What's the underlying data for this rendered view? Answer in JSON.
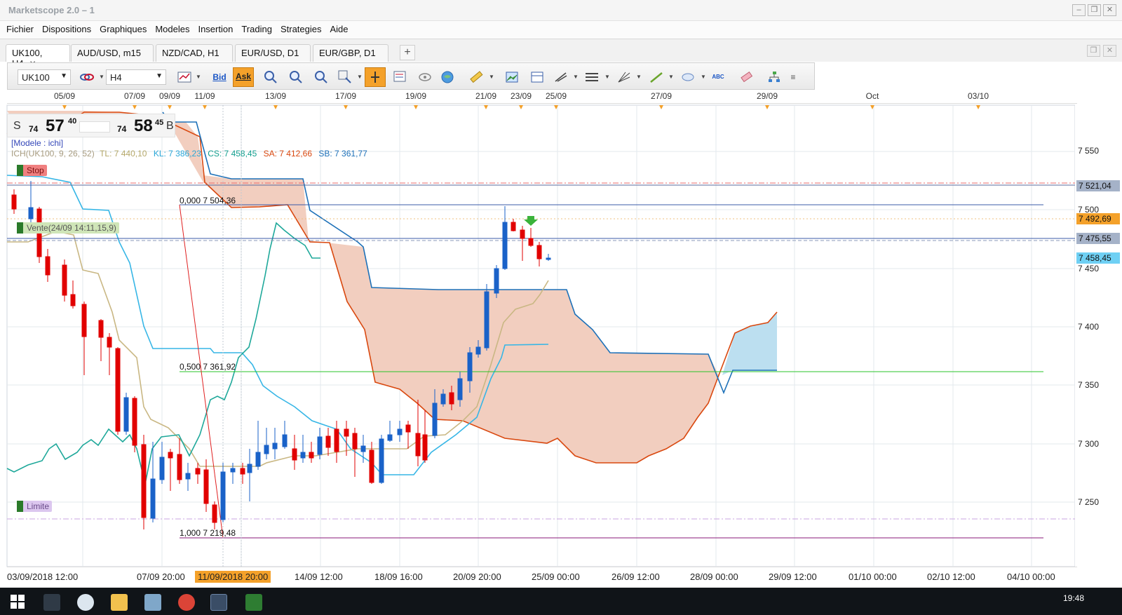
{
  "window": {
    "title": "Marketscope 2.0 – 1"
  },
  "menu": [
    "Fichier",
    "Dispositions",
    "Graphiques",
    "Modeles",
    "Insertion",
    "Trading",
    "Strategies",
    "Aide"
  ],
  "tabs": [
    {
      "label": "UK100, H4",
      "active": true,
      "close": "✕"
    },
    {
      "label": "AUD/USD, m15"
    },
    {
      "label": "NZD/CAD, H1"
    },
    {
      "label": "EUR/USD, D1"
    },
    {
      "label": "EUR/GBP, D1"
    }
  ],
  "toolbar": {
    "symbol": "UK100",
    "timeframe": "H4",
    "bid_label": "Bid",
    "ask_label": "Ask"
  },
  "top_dates": [
    "05/09",
    "07/09",
    "09/09",
    "11/09",
    "13/09",
    "17/09",
    "19/09",
    "21/09",
    "23/09",
    "25/09",
    "27/09",
    "29/09",
    "Oct",
    "03/10"
  ],
  "quote": {
    "sell_letter": "S",
    "sell_small": "74",
    "sell_big": "57",
    "sell_sup": "40",
    "buy_small": "74",
    "buy_big": "58",
    "buy_sup": "45",
    "buy_letter": "B"
  },
  "model_line": "[Modele : ichi]",
  "ichimoku": {
    "name": "ICH(UK100, 9, 26, 52)",
    "tl": "TL: 7 440,10",
    "kl": "KL: 7 386,23",
    "cs": "CS: 7 458,45",
    "sa": "SA: 7 412,66",
    "sb": "SB: 7 361,77",
    "colors": {
      "tl": "#c9b783",
      "kl": "#36b6e6",
      "cs": "#1ea89a",
      "sa": "#d9480f",
      "sb": "#1c70b8",
      "cloud": "#f2c9b6"
    }
  },
  "tags": {
    "stop": "Stop",
    "vente": "Vente(24/09 14:11,15,9)",
    "limite": "Limite"
  },
  "fib": {
    "f0": "0,000 7 504,36",
    "f50": "0,500 7 361,92",
    "f100": "1,000 7 219,48"
  },
  "price_axis": {
    "ticks": [
      "7 550",
      "7 500",
      "7 450",
      "7 400",
      "7 350",
      "7 300",
      "7 250"
    ],
    "labels": {
      "stop": "7 521,04",
      "ask": "7 492,69",
      "entry": "7 475,55",
      "cs": "7 458,45"
    }
  },
  "bottom_dates": [
    "03/09/2018 12:00",
    "07/09 20:00",
    "11/09/2018 20:00",
    "14/09 12:00",
    "18/09 16:00",
    "20/09 20:00",
    "25/09 00:00",
    "26/09 12:00",
    "28/09 00:00",
    "29/09 12:00",
    "01/10 00:00",
    "02/10 12:00",
    "04/10 00:00"
  ],
  "taskbar": {
    "time": "19:48"
  }
}
